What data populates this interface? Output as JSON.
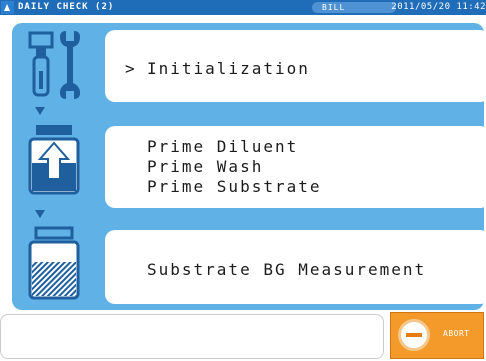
{
  "header": {
    "title": "DAILY CHECK (2)",
    "user": "BILL",
    "datetime": "2011/05/20 11:42",
    "app_icon": "app-icon"
  },
  "steps": [
    {
      "icon": "tools-icon",
      "lines": [
        "Initialization"
      ],
      "marker": ">"
    },
    {
      "icon": "bottle-fill-icon",
      "lines": [
        "Prime Diluent",
        "Prime Wash",
        "Prime Substrate"
      ]
    },
    {
      "icon": "bottle-measure-icon",
      "lines": [
        "Substrate BG Measurement"
      ]
    }
  ],
  "footer": {
    "message": "",
    "abort_label": "ABORT"
  },
  "colors": {
    "header": "#1f6cb8",
    "panel": "#5fb1e6",
    "icon_dark": "#1f5f9e",
    "abort": "#f39a2a"
  }
}
